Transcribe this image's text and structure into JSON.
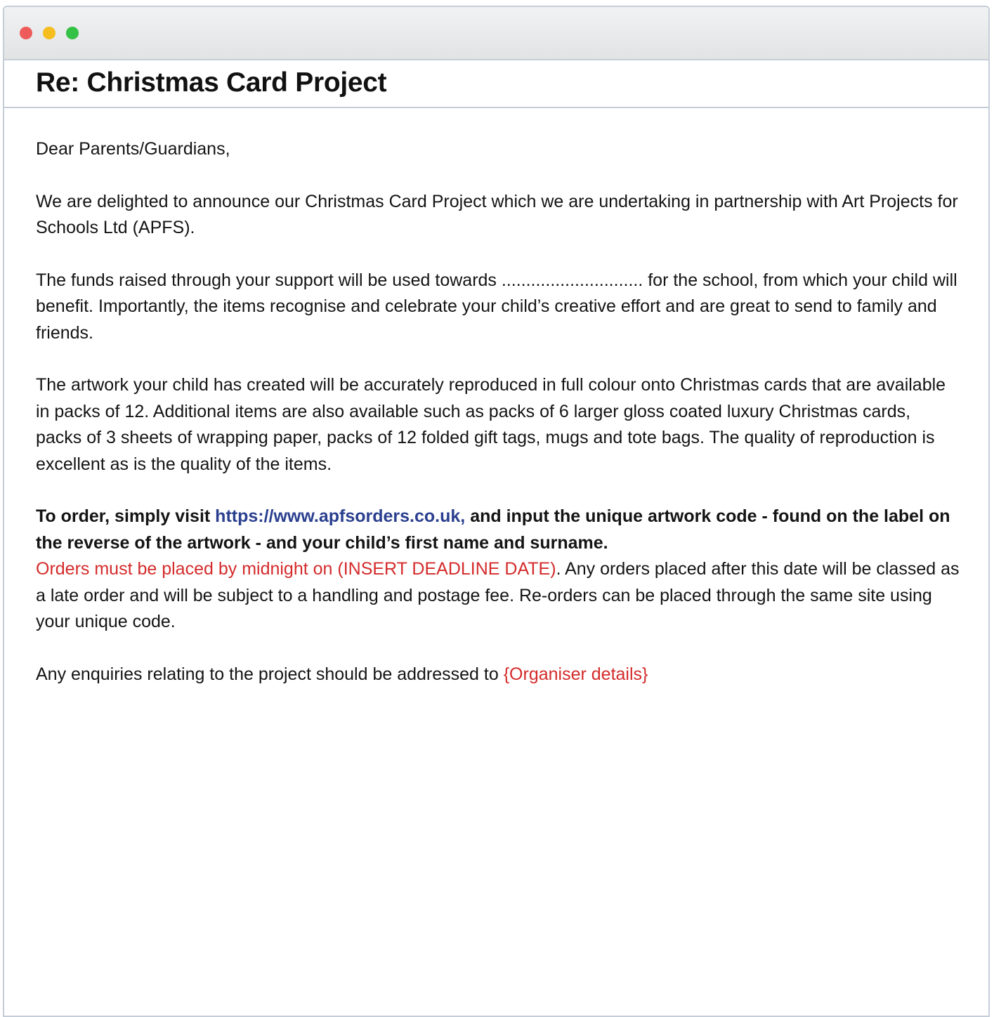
{
  "window": {
    "controls": [
      "close-icon",
      "minimize-icon",
      "maximize-icon"
    ],
    "colors": {
      "close": "#ee5b5b",
      "minimize": "#f5bd1d",
      "maximize": "#33c146"
    }
  },
  "email": {
    "subject": "Re: Christmas Card Project",
    "greeting": "Dear Parents/Guardians,",
    "para1": "We are delighted to announce our Christmas Card Project which we are undertaking in partnership with Art Projects for Schools Ltd (APFS).",
    "para2": "The funds raised through your support will be used towards ............................. for the school, from which your child will benefit. Importantly, the items recognise and celebrate your child’s creative effort and are great to send to family and friends.",
    "para3": "The artwork your child has created will be accurately reproduced in full colour onto Christmas cards that are available in packs of 12. Additional items are also available such as packs of 6 larger gloss coated luxury Christmas cards, packs of 3 sheets of wrapping paper, packs of 12 folded gift tags, mugs and tote bags. The quality of reproduction is excellent as is the quality of the items.",
    "order": {
      "intro": "To order, simply visit ",
      "link": "https://www.apfsorders.co.uk,",
      "after_link": " and input the unique artwork code - found on the label on the reverse of the artwork - and your child’s first name and surname.",
      "deadline": "Orders must be placed by midnight on (INSERT DEADLINE DATE)",
      "rest": ". Any orders placed after this date will be classed as a late order and will be subject to a handling and postage fee. Re-orders can be placed through the same site using your unique code."
    },
    "enquiries": {
      "text": "Any enquiries relating to the project should be addressed to ",
      "organiser": "{Organiser details}"
    }
  },
  "colors": {
    "link": "#2a3f8f",
    "placeholder_red": "#d42b2b",
    "border": "#c5ced8"
  }
}
